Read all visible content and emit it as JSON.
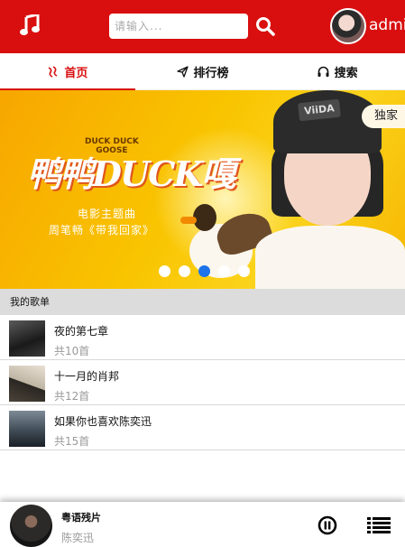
{
  "header": {
    "search_placeholder": "请输入...",
    "user_name": "admin"
  },
  "tabs": [
    {
      "label": "首页",
      "icon": "home-icon",
      "active": true
    },
    {
      "label": "排行榜",
      "icon": "paper-plane-icon",
      "active": false
    },
    {
      "label": "搜索",
      "icon": "headphones-icon",
      "active": false
    }
  ],
  "banner": {
    "title": "鸭鸭DUCK嘎",
    "tag_line1": "DUCK DUCK",
    "tag_line2": "GOOSE",
    "subtitle_line1": "电影主题曲",
    "subtitle_line2": "周笔畅《带我回家》",
    "hat_text": "ViiDA",
    "exclusive_label": "独家",
    "active_slide": 2,
    "slide_count": 5
  },
  "playlist_section": {
    "title": "我的歌单",
    "items": [
      {
        "name": "夜的第七章",
        "count": "共10首"
      },
      {
        "name": "十一月的肖邦",
        "count": "共12首"
      },
      {
        "name": "如果你也喜欢陈奕迅",
        "count": "共15首"
      }
    ]
  },
  "player": {
    "title": "粤语残片",
    "artist": "陈奕迅",
    "state": "playing"
  },
  "colors": {
    "brand_red": "#d90f0f",
    "active_dot": "#1e73e8",
    "banner_yellow": "#f9c400"
  }
}
